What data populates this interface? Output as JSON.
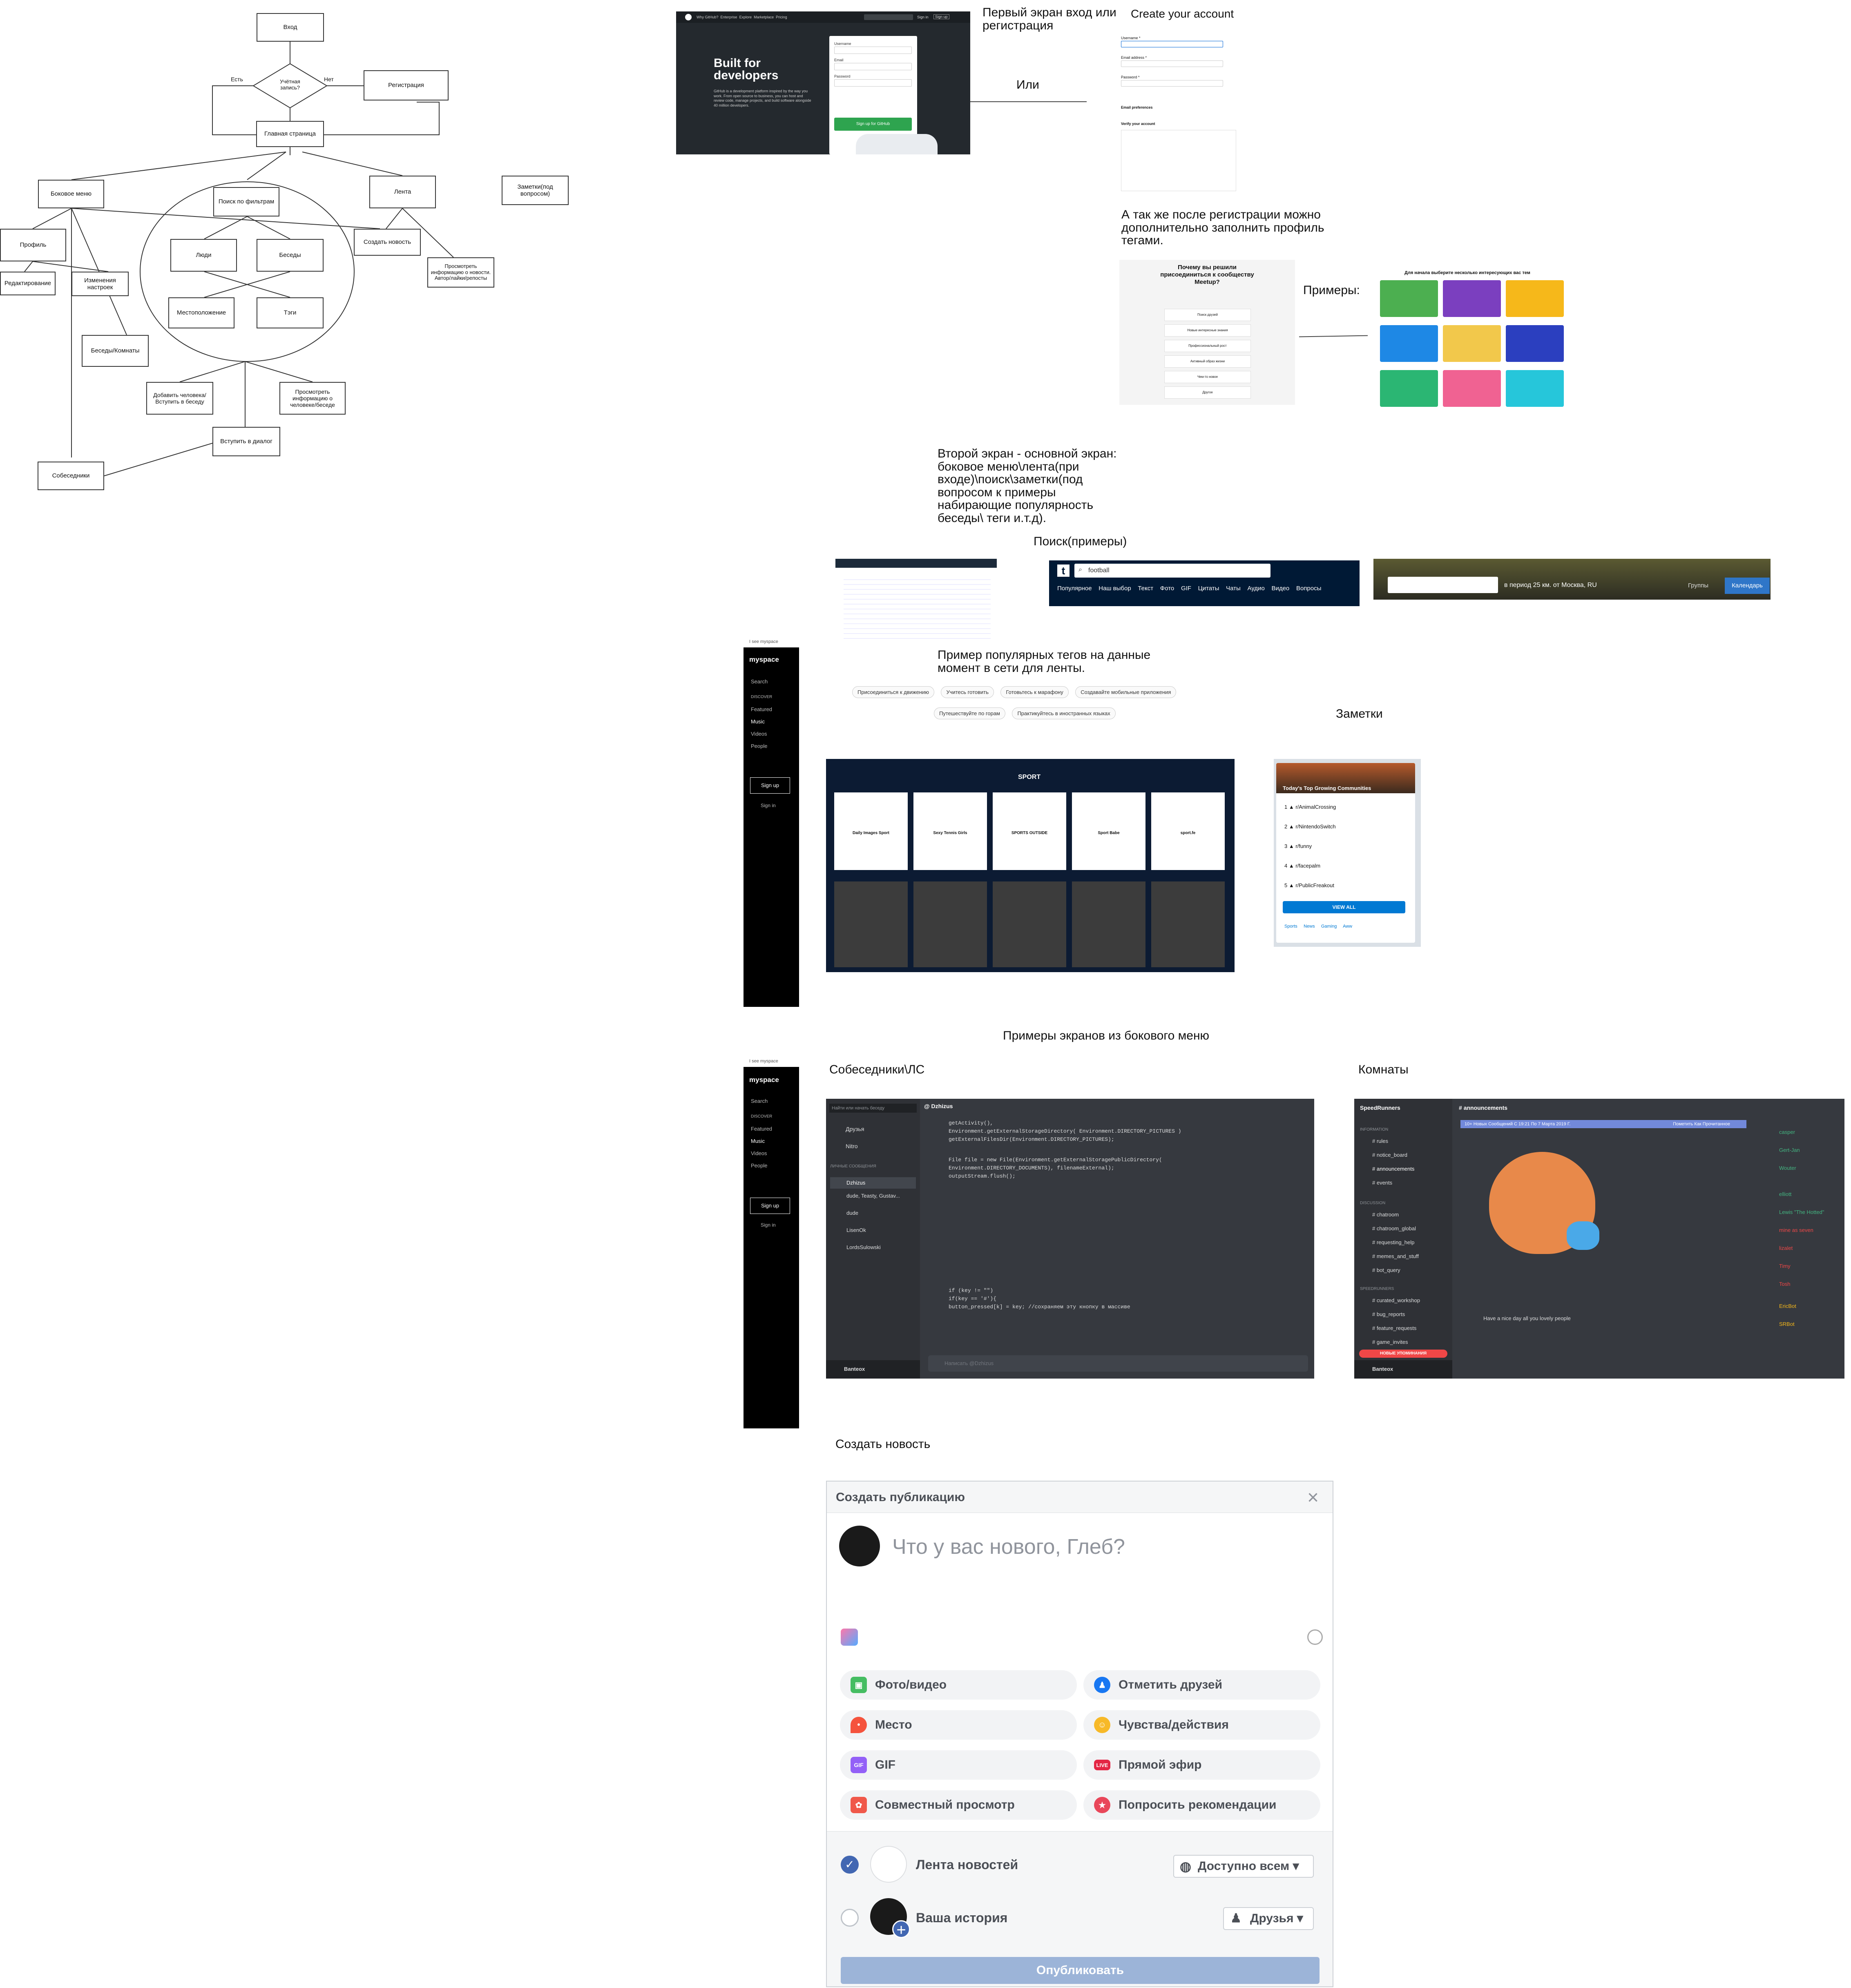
{
  "flowchart": {
    "start": "Вход",
    "decision": "Учётная запись?",
    "yes": "Есть",
    "no": "Нет",
    "register": "Регистрация",
    "main": "Главная страница",
    "side_menu": "Боковое меню",
    "search_filters": "Поиск по фильтрам",
    "feed": "Лента",
    "notes": "Заметки(под вопросом)",
    "profile": "Профиль",
    "create_news": "Создать новость",
    "view_news": "Просмотреть информацию о новости. Автор/лайки/репосты",
    "edit": "Редактирование",
    "change_settings": "Изменения настроек",
    "chats_rooms": "Беседы/Комнаты",
    "people": "Люди",
    "chats": "Беседы",
    "location": "Местоположение",
    "tags": "Тэги",
    "add_person": "Добавить человека/Вступить в беседу",
    "view_info": "Просмотреть информацию о человеке/беседе",
    "join_dialog": "Вступить в диалог",
    "interlocutors": "Собеседники"
  },
  "annotations": {
    "first_screen": "Первый экран вход или регистрация",
    "or": "Или",
    "after_reg": "А так же после регистрации можно дополнительно заполнить профиль тегами.",
    "examples": "Примеры:",
    "second_screen": "Второй экран - основной экран: боковое меню\\лента(при входе)\\поиск\\заметки(под вопросом к примеры набирающие популярность беседы\\ теги и.т.д).",
    "search_examples": "Поиск(примеры)",
    "popular_tags": "Пример популярных тегов на данные момент в сети для ленты.",
    "notes": "Заметки",
    "side_menu_examples": "Примеры экранов из бокового меню",
    "dm": "Собеседники\\ЛС",
    "rooms": "Комнаты",
    "create_news": "Создать новость"
  },
  "github": {
    "nav": [
      "Why GitHub?",
      "Enterprise",
      "Explore",
      "Marketplace",
      "Pricing"
    ],
    "signin": "Sign in",
    "signup": "Sign up",
    "headline": "Built for developers",
    "body": "GitHub is a development platform inspired by the way you work. From open source to business, you can host and review code, manage projects, and build software alongside 40 million developers.",
    "username": "Username",
    "email": "Email",
    "password": "Password",
    "cta": "Sign up for GitHub"
  },
  "create_account": {
    "title": "Create your account",
    "username": "Username *",
    "email": "Email address *",
    "password": "Password *",
    "email_pref": "Email preferences",
    "verify": "Verify your account"
  },
  "meetup": {
    "title": "Почему вы решили присоединиться к сообществу Meetup?",
    "options": [
      "Поиск друзей",
      "Новые интересные знания",
      "Профессиональный рост",
      "Активный образ жизни",
      "Чем-то новое",
      "Другое"
    ]
  },
  "interests": {
    "title": "Для начала выберите несколько интересующих вас тем"
  },
  "myspace": {
    "logo": "myspace",
    "top": "I see myspace",
    "search": "Search",
    "discover": "DISCOVER",
    "items": [
      "Featured",
      "Music",
      "Videos",
      "People"
    ],
    "signup": "Sign up",
    "signin": "Sign in"
  },
  "search_tumblr": {
    "query": "football",
    "tabs": [
      "Популярное",
      "Наш выбор",
      "Текст",
      "Фото",
      "GIF",
      "Цитаты",
      "Чаты",
      "Аудио",
      "Видео",
      "Вопросы"
    ]
  },
  "search_vk": {
    "range": "в период 25 км. от Москва, RU",
    "groups": "Группы",
    "calendar": "Календарь"
  },
  "tags": [
    "Присоединиться к движению",
    "Учитесь готовить",
    "Готовьтесь к марафону",
    "Создавайте мобильные приложения",
    "Путешествуйте по горам",
    "Практикуйтесь в иностранных языках"
  ],
  "reddit": {
    "title": "Today's Top Growing Communities",
    "rows": [
      {
        "rank": "1",
        "name": "r/AnimalCrossing"
      },
      {
        "rank": "2",
        "name": "r/NintendoSwitch"
      },
      {
        "rank": "3",
        "name": "r/funny"
      },
      {
        "rank": "4",
        "name": "r/facepalm"
      },
      {
        "rank": "5",
        "name": "r/PublicFreakout"
      }
    ],
    "view_all": "VIEW ALL",
    "tags": [
      "Sports",
      "News",
      "Gaming",
      "Aww"
    ]
  },
  "sport": {
    "title": "SPORT",
    "cards": [
      "Daily Images Sport",
      "Sexy Tennis Girls",
      "SPORTS OUTSIDE",
      "Sport Babe",
      "sport.fe"
    ]
  },
  "dm": {
    "search": "Найти или начать беседу",
    "friends": "Друзья",
    "nitro": "Nitro",
    "dm_header": "ЛИЧНЫЕ СООБЩЕНИЯ",
    "contacts": [
      "Dzhizus",
      "dude, Teasty, Gustav...",
      "dude",
      "LisenOk",
      "LordsSulowski"
    ],
    "user": "Banteox",
    "channel": "Dzhizus",
    "code": [
      "getActivity(),",
      "Environment.getExternalStorageDirectory( Environment.DIRECTORY_PICTURES )",
      "getExternalFilesDir(Environment.DIRECTORY_PICTURES);",
      "File file = new File(Environment.getExternalStoragePublicDirectory(",
      "Environment.DIRECTORY_DOCUMENTS), filenameExternal);",
      "outputStream.flush();",
      "if (key != \"\")",
      "if(key == '#'){",
      "button_pressed[k] = key; //сохраняем эту кнопку в массиве"
    ],
    "input": "Написать @Dzhizus"
  },
  "rooms": {
    "server": "SpeedRunners",
    "channel": "announcements",
    "banner": "10+ Новых Сообщений С 19:21 По 7 Марта 2019 Г.",
    "mark_read": "Пометить Как Прочитанное",
    "categories": [
      "INFORMATION",
      "DISCUSSION",
      "SPEEDRUNNERS"
    ],
    "channels": [
      "rules",
      "notice_board",
      "announcements",
      "events",
      "chatroom",
      "chatroom_global",
      "requesting_help",
      "memes_and_stuff",
      "bot_query",
      "curated_workshop",
      "bug_reports",
      "feature_requests",
      "game_invites"
    ],
    "message": "Have a nice day all you lovely people",
    "members": [
      "casper",
      "Gert-Jan",
      "Wouter",
      "elliott",
      "Lewis \"The Hotted\"",
      "mine as seven",
      "lizalet",
      "Timy",
      "Tosh",
      "EricBot",
      "SRBot"
    ],
    "new_mentions": "НОВЫЕ УПОМИНАНИЯ",
    "user": "Banteox"
  },
  "fb": {
    "title": "Создать публикацию",
    "placeholder": "Что у вас нового, Глеб?",
    "options": [
      "Фото/видео",
      "Отметить друзей",
      "Место",
      "Чувства/действия",
      "GIF",
      "Прямой эфир",
      "Совместный просмотр",
      "Попросить рекомендации"
    ],
    "live_badge": "LIVE",
    "news_feed": "Лента новостей",
    "visibility": "Доступно всем",
    "story": "Ваша история",
    "friends": "Друзья",
    "publish": "Опубликовать"
  },
  "colors": {
    "github_dark": "#24292e",
    "github_green": "#2ea44f",
    "discord_bg": "#36393f",
    "discord_side": "#2f3136",
    "fb_blue": "#4267b2",
    "reddit_blue": "#0079d3"
  }
}
